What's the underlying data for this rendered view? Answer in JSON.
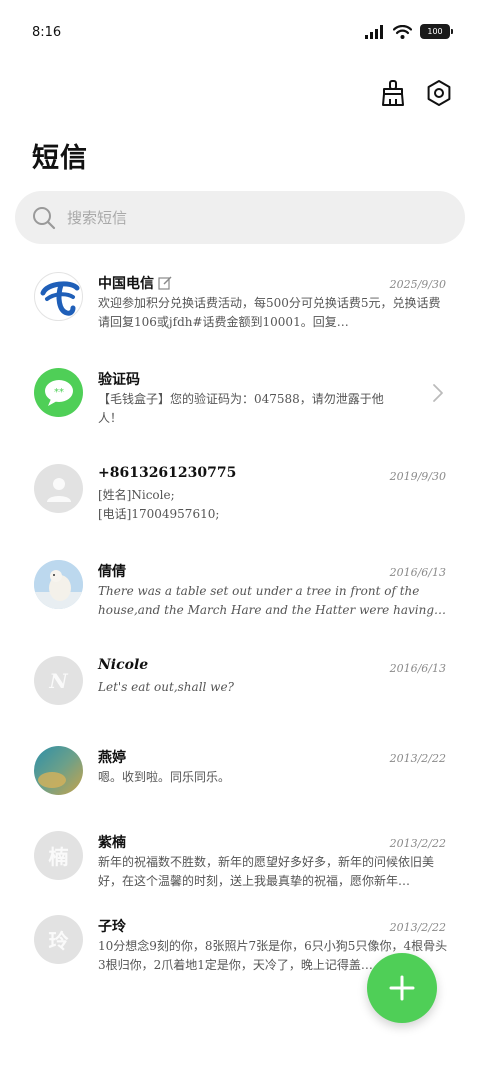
{
  "status_bar": {
    "time": "8:16",
    "battery": "100"
  },
  "header": {
    "title": "短信"
  },
  "search": {
    "placeholder": "搜索短信"
  },
  "messages": [
    {
      "name": "中国电信",
      "time": "2025/9/30",
      "preview": "欢迎参加积分兑换话费活动，每500分可兑换话费5元，兑换话费请回复106或jfdh#话费金额到10001。回复…"
    },
    {
      "name": "验证码",
      "time": "",
      "preview": "【毛钱盒子】您的验证码为：047588，请勿泄露于他人！"
    },
    {
      "name": "+8613261230775",
      "time": "2019/9/30",
      "preview": "[姓名]Nicole;\n[电话]17004957610;"
    },
    {
      "name": "倩倩",
      "time": "2016/6/13",
      "preview": "There was a table set out under a tree in front of the house,and the March Hare and the Hatter were having tea at it."
    },
    {
      "name": "Nicole",
      "time": "2016/6/13",
      "preview": "Let's eat out,shall we?",
      "avatar_letter": "N"
    },
    {
      "name": "燕婷",
      "time": "2013/2/22",
      "preview": "嗯。收到啦。同乐同乐。"
    },
    {
      "name": "紫楠",
      "time": "2013/2/22",
      "preview": "新年的祝福数不胜数，新年的愿望好多好多，新年的问候依旧美好，在这个温馨的时刻，送上我最真挚的祝福，愿你新年…",
      "avatar_letter": "楠"
    },
    {
      "name": "子玲",
      "time": "2013/2/22",
      "preview": "10分想念9刻的你，8张照片7张是你，6只小狗5只像你，4根骨头3根归你，2爪着地1定是你，天冷了，晚上记得盖…",
      "avatar_letter": "玲"
    }
  ],
  "colors": {
    "accent_green": "#4fcf57",
    "telecom_blue": "#1f5fb8",
    "search_bg": "#efefef"
  }
}
